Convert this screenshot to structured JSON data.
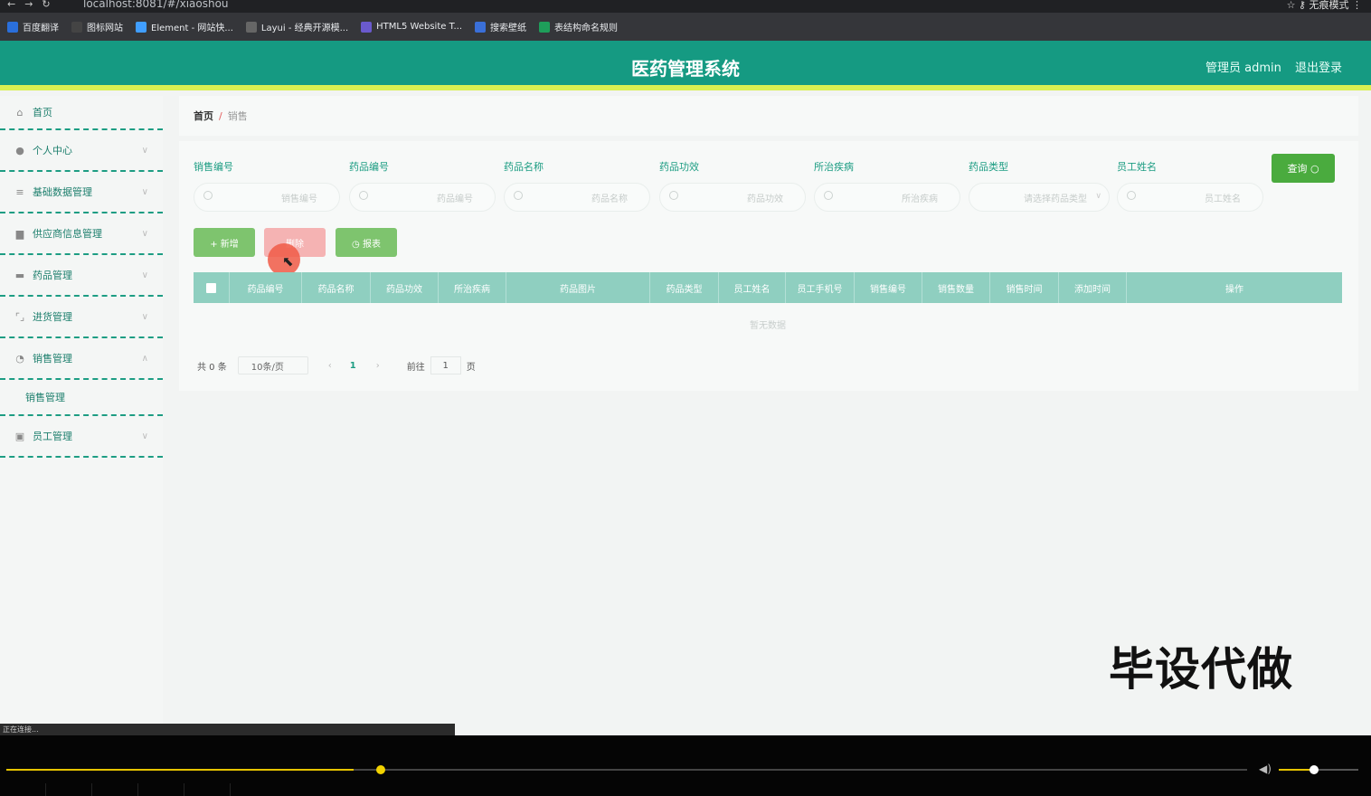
{
  "browser": {
    "url": "localhost:8081/#/xiaoshou",
    "profile": "无痕模式"
  },
  "bookmarks": [
    {
      "label": "百度翻译",
      "color": "#2a6fdb"
    },
    {
      "label": "图标网站",
      "color": "#444"
    },
    {
      "label": "Element - 网站快...",
      "color": "#409eff"
    },
    {
      "label": "Layui - 经典开源模...",
      "color": "#666"
    },
    {
      "label": "HTML5 Website T...",
      "color": "#6a5acd"
    },
    {
      "label": "搜索壁纸",
      "color": "#3a6fd8"
    },
    {
      "label": "表结构命名规则",
      "color": "#1e9e5a"
    }
  ],
  "header": {
    "title": "医药管理系统",
    "admin": "管理员 admin",
    "logout": "退出登录"
  },
  "sidebar": {
    "home": "首页",
    "items": [
      {
        "label": "个人中心",
        "icon": "user-icon"
      },
      {
        "label": "基础数据管理",
        "icon": "list-icon"
      },
      {
        "label": "供应商信息管理",
        "icon": "truck-icon"
      },
      {
        "label": "药品管理",
        "icon": "box-icon"
      },
      {
        "label": "进货管理",
        "icon": "frame-icon"
      },
      {
        "label": "销售管理",
        "icon": "gauge-icon"
      },
      {
        "label": "员工管理",
        "icon": "badge-icon"
      }
    ],
    "sub": "销售管理"
  },
  "breadcrumb": {
    "home": "首页",
    "sep": "/",
    "current": "销售"
  },
  "filters": [
    {
      "label": "销售编号",
      "placeholder": "销售编号"
    },
    {
      "label": "药品编号",
      "placeholder": "药品编号"
    },
    {
      "label": "药品名称",
      "placeholder": "药品名称"
    },
    {
      "label": "药品功效",
      "placeholder": "药品功效"
    },
    {
      "label": "所治疾病",
      "placeholder": "所治疾病"
    },
    {
      "label": "药品类型",
      "placeholder": "请选择药品类型"
    },
    {
      "label": "员工姓名",
      "placeholder": "员工姓名"
    }
  ],
  "buttons": {
    "query": "查询",
    "add": "+ 新增",
    "delete": "删除",
    "report": "◷ 报表"
  },
  "table": {
    "columns": [
      "药品编号",
      "药品名称",
      "药品功效",
      "所治疾病",
      "药品图片",
      "药品类型",
      "员工姓名",
      "员工手机号",
      "销售编号",
      "销售数量",
      "销售时间",
      "添加时间",
      "操作"
    ],
    "empty": "暂无数据"
  },
  "pagination": {
    "total": "共 0 条",
    "page_size": "10条/页",
    "current": "1",
    "goto": "前往",
    "goto_value": "1",
    "unit": "页"
  },
  "overlay": {
    "watermark": "毕设代做",
    "status": "正在连接..."
  },
  "video": {
    "progress": 0.28,
    "volume": 0.4
  }
}
